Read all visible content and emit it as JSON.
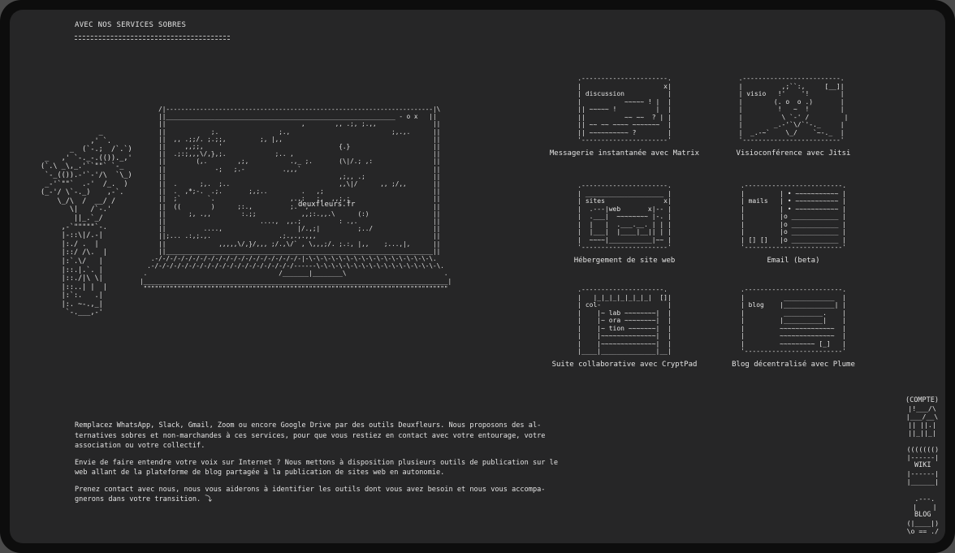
{
  "header": {
    "title": "AVEC NOS SERVICES SOBRES"
  },
  "laptop": {
    "url": "deuxfleurs.fr"
  },
  "services": [
    {
      "label": "Messagerie instantanée avec Matrix",
      "icon": "chat-window-icon"
    },
    {
      "label": "Visioconférence avec Jitsi",
      "icon": "video-call-icon"
    },
    {
      "label": "Hébergement de site web",
      "icon": "website-icon"
    },
    {
      "label": "Email (beta)",
      "icon": "mail-list-icon"
    },
    {
      "label": "Suite collaborative avec CryptPad",
      "icon": "collab-document-icon"
    },
    {
      "label": "Blog décentralisé avec Plume",
      "icon": "blog-page-icon"
    }
  ],
  "ascii": {
    "discussion_label": "discussion",
    "visio_label": "visio",
    "sites_label": "sites",
    "web_label": "web",
    "mails_label": "mails",
    "col_label": "col-",
    "lab": "~ lab",
    "ora": "~ ora",
    "tion": "~ tion",
    "blog_label": "blog"
  },
  "description": {
    "p1": "Remplacez WhatsApp, Slack, Gmail, Zoom ou encore Google Drive par des outils Deuxfleurs. Nous proposons des al-ternatives sobres et non-marchandes à ces services, pour que vous restiez en contact avec votre entourage, votre association ou votre collectif.",
    "p2": "Envie de faire entendre votre voix sur Internet ? Nous mettons à disposition plusieurs outils de publication sur le web allant de la plateforme de blog partagée à la publication de sites web en autonomie.",
    "p3": "Prenez contact avec nous, nous vous aiderons à identifier les outils dont vous avez besoin et nous vous accompa-gnerons dans votre transition. ⤵"
  },
  "side_nav": {
    "compte": "(COMPTE)",
    "wiki": "WIKI",
    "blog": "BLOG"
  }
}
